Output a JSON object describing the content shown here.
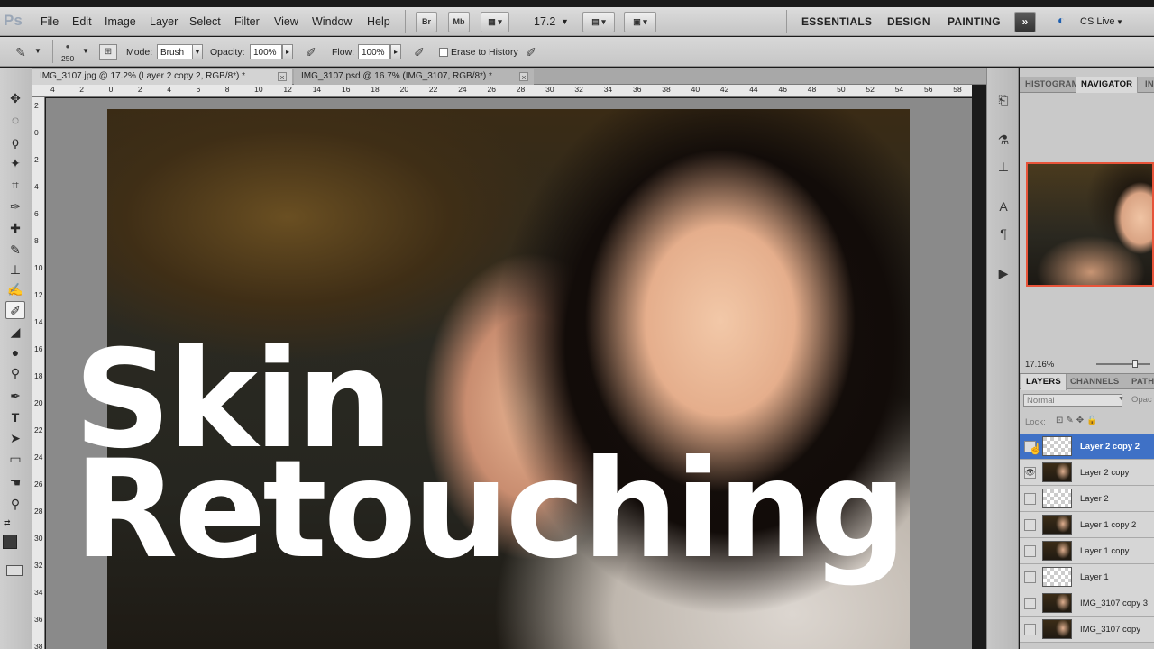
{
  "app": {
    "logo": "Ps"
  },
  "menu": [
    "File",
    "Edit",
    "Image",
    "Layer",
    "Select",
    "Filter",
    "View",
    "Window",
    "Help"
  ],
  "appbar": {
    "bridge": "Br",
    "minibridge": "Mb",
    "zoom": "17.2"
  },
  "workspaces": [
    "ESSENTIALS",
    "DESIGN",
    "PAINTING"
  ],
  "cs_live": "CS Live",
  "options": {
    "brush_size": "250",
    "mode_label": "Mode:",
    "mode_value": "Brush",
    "opacity_label": "Opacity:",
    "opacity_value": "100%",
    "flow_label": "Flow:",
    "flow_value": "100%",
    "erase_history_label": "Erase to History"
  },
  "tabs": [
    {
      "title": "IMG_3107.jpg @ 17.2% (Layer 2 copy 2, RGB/8*) *"
    },
    {
      "title": "IMG_3107.psd @ 16.7% (IMG_3107, RGB/8*) *"
    }
  ],
  "ruler_top": [
    "4",
    "2",
    "0",
    "2",
    "4",
    "6",
    "8",
    "10",
    "12",
    "14",
    "16",
    "18",
    "20",
    "22",
    "24",
    "26",
    "28",
    "30",
    "32",
    "34",
    "36",
    "38",
    "40",
    "42",
    "44",
    "46",
    "48",
    "50",
    "52",
    "54",
    "56",
    "58"
  ],
  "ruler_left": [
    "2",
    "0",
    "2",
    "4",
    "6",
    "8",
    "10",
    "12",
    "14",
    "16",
    "18",
    "20",
    "22",
    "24",
    "26",
    "28",
    "30",
    "32",
    "34",
    "36",
    "38"
  ],
  "headline": {
    "line1": "Skin",
    "line2": "Retouching"
  },
  "panels": {
    "top_tabs": [
      "HISTOGRAM",
      "NAVIGATOR",
      "INFO"
    ],
    "nav_zoom": "17.16%",
    "layer_tabs": [
      "LAYERS",
      "CHANNELS",
      "PATHS"
    ],
    "blend_mode": "Normal",
    "opacity_label": "Opac",
    "lock_label": "Lock:"
  },
  "layers": [
    {
      "name": "Layer 2 copy 2",
      "thumb": "checker",
      "visible": false,
      "selected": true
    },
    {
      "name": "Layer 2 copy",
      "thumb": "photo",
      "visible": true,
      "selected": false
    },
    {
      "name": "Layer 2",
      "thumb": "checker",
      "visible": false,
      "selected": false
    },
    {
      "name": "Layer 1 copy 2",
      "thumb": "photo",
      "visible": false,
      "selected": false
    },
    {
      "name": "Layer 1 copy",
      "thumb": "photo",
      "visible": false,
      "selected": false
    },
    {
      "name": "Layer 1",
      "thumb": "checker",
      "visible": false,
      "selected": false
    },
    {
      "name": "IMG_3107 copy 3",
      "thumb": "photo",
      "visible": false,
      "selected": false
    },
    {
      "name": "IMG_3107 copy",
      "thumb": "photo",
      "visible": false,
      "selected": false
    }
  ],
  "icons": {
    "tools": [
      "move-tool-icon",
      "marquee-tool-icon",
      "lasso-tool-icon",
      "quick-select-tool-icon",
      "crop-tool-icon",
      "eyedropper-tool-icon",
      "healing-brush-tool-icon",
      "brush-tool-icon",
      "clone-stamp-tool-icon",
      "history-brush-tool-icon",
      "eraser-tool-icon",
      "paint-bucket-tool-icon",
      "blur-tool-icon",
      "dodge-tool-icon",
      "pen-tool-icon",
      "type-tool-icon",
      "path-select-tool-icon",
      "rectangle-tool-icon",
      "hand-tool-icon",
      "zoom-tool-icon"
    ]
  }
}
